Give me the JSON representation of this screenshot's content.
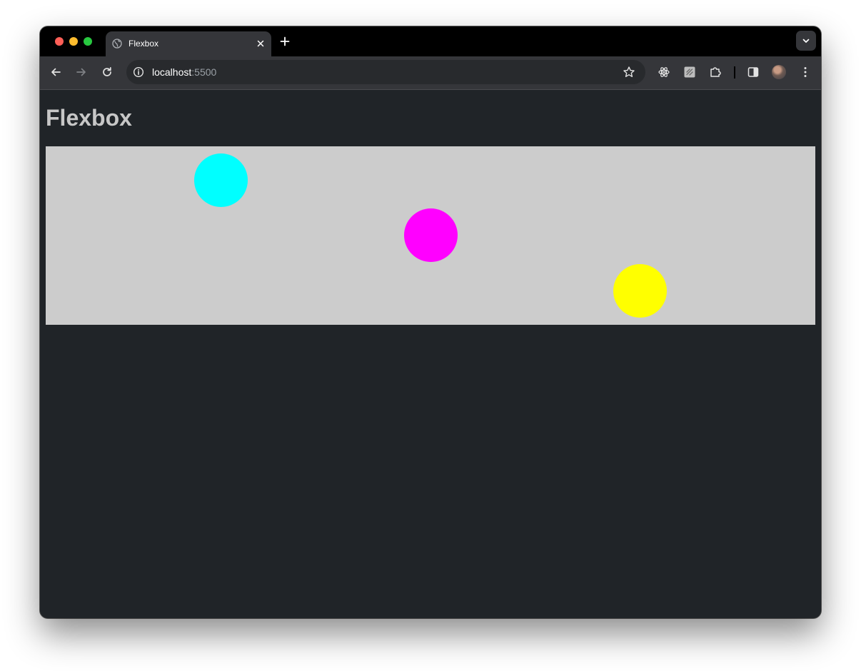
{
  "browser": {
    "tab": {
      "title": "Flexbox",
      "favicon": "globe-icon"
    },
    "address_bar": {
      "host": "localhost",
      "port": ":5500"
    },
    "toolbar_icons": [
      "back-arrow-icon",
      "forward-arrow-icon",
      "reload-icon",
      "site-info-icon",
      "bookmark-star-icon",
      "react-devtools-icon",
      "extension-icon",
      "puzzle-extensions-icon",
      "side-panel-icon",
      "profile-avatar",
      "more-menu-icon"
    ]
  },
  "page": {
    "title": "Flexbox",
    "container_color": "#cccccc",
    "circles": [
      {
        "color": "#00ffff"
      },
      {
        "color": "#ff00ff"
      },
      {
        "color": "#ffff00"
      }
    ]
  },
  "colors": {
    "page_background": "#202428",
    "title_text": "#c7c7c7"
  }
}
